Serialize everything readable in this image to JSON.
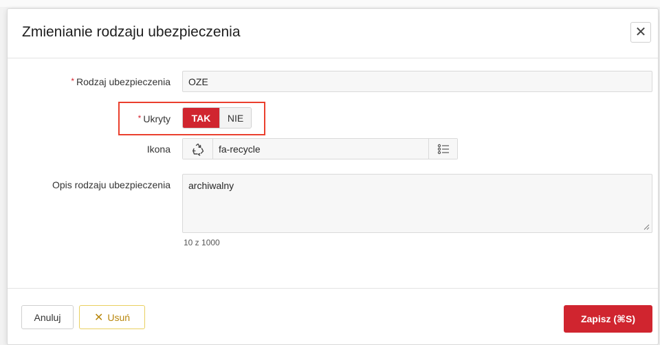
{
  "dialog": {
    "title": "Zmienianie rodzaju ubezpieczenia",
    "close_icon": "close-icon"
  },
  "form": {
    "type": {
      "label": "Rodzaj ubezpieczenia",
      "required": "*",
      "value": "OZE"
    },
    "hidden": {
      "label": "Ukryty",
      "required": "*",
      "option_yes": "TAK",
      "option_no": "NIE",
      "selected": "TAK"
    },
    "icon": {
      "label": "Ikona",
      "preview_icon": "recycle-icon",
      "value": "fa-recycle",
      "picker_icon": "list-picker-icon"
    },
    "description": {
      "label": "Opis rodzaju ubezpieczenia",
      "value": "archiwalny",
      "counter": "10 z 1000"
    }
  },
  "footer": {
    "cancel_label": "Anuluj",
    "delete_label": "Usuń",
    "save_label": "Zapisz (⌘S)"
  },
  "colors": {
    "accent_red": "#d0252f",
    "highlight": "#ea3e2c",
    "delete_border": "#e9cf5e",
    "delete_text": "#b8860b"
  }
}
